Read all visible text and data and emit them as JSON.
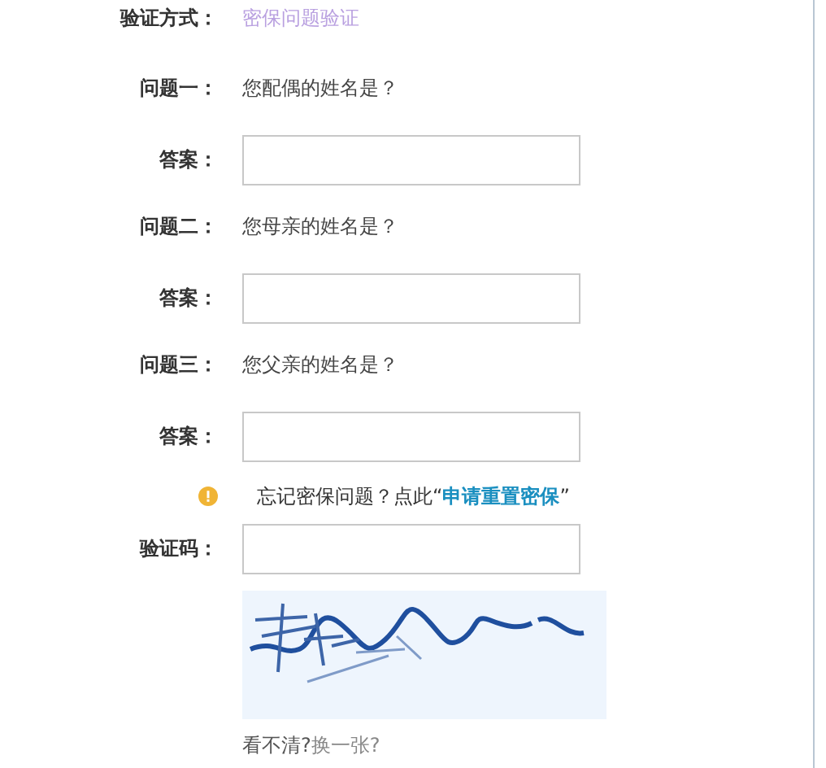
{
  "verify_method": {
    "label": "验证方式：",
    "value": "密保问题验证"
  },
  "questions": [
    {
      "label": "问题一：",
      "question": "您配偶的姓名是？",
      "answer_label": "答案："
    },
    {
      "label": "问题二：",
      "question": "您母亲的姓名是？",
      "answer_label": "答案："
    },
    {
      "label": "问题三：",
      "question": "您父亲的姓名是？",
      "answer_label": "答案："
    }
  ],
  "notice": {
    "text": "忘记密保问题？点此“",
    "link": "申请重置密保",
    "text_after": "”"
  },
  "captcha": {
    "label": "验证码：",
    "hint": "看不清?",
    "refresh_link": "换一张?"
  }
}
